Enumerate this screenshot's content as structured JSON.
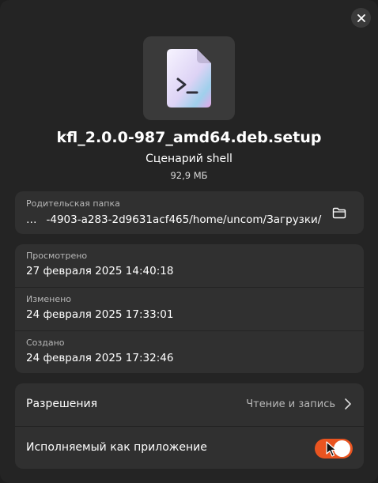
{
  "header": {
    "file_icon": "terminal-script-file-icon",
    "close_icon": "close-icon"
  },
  "file": {
    "name": "kfl_2.0.0-987_amd64.deb.setup",
    "type": "Сценарий shell",
    "size": "92,9 МБ"
  },
  "parent": {
    "label": "Родительская папка",
    "ellipsis": "…",
    "path": "-4903-a283-2d9631acf465/home/uncom/Загрузки/",
    "open_icon": "folder-icon"
  },
  "dates": [
    {
      "label": "Просмотрено",
      "value": "27 февраля 2025 14:40:18"
    },
    {
      "label": "Изменено",
      "value": "24 февраля 2025 17:33:01"
    },
    {
      "label": "Создано",
      "value": "24 февраля 2025 17:32:46"
    }
  ],
  "permissions": {
    "label": "Разрешения",
    "value": "Чтение и запись",
    "chevron_icon": "chevron-right-icon"
  },
  "executable": {
    "label": "Исполняемый как приложение",
    "enabled": true,
    "toggle_color": "#e95420"
  },
  "colors": {
    "background": "#242424",
    "card": "#303030",
    "accent": "#e95420"
  }
}
